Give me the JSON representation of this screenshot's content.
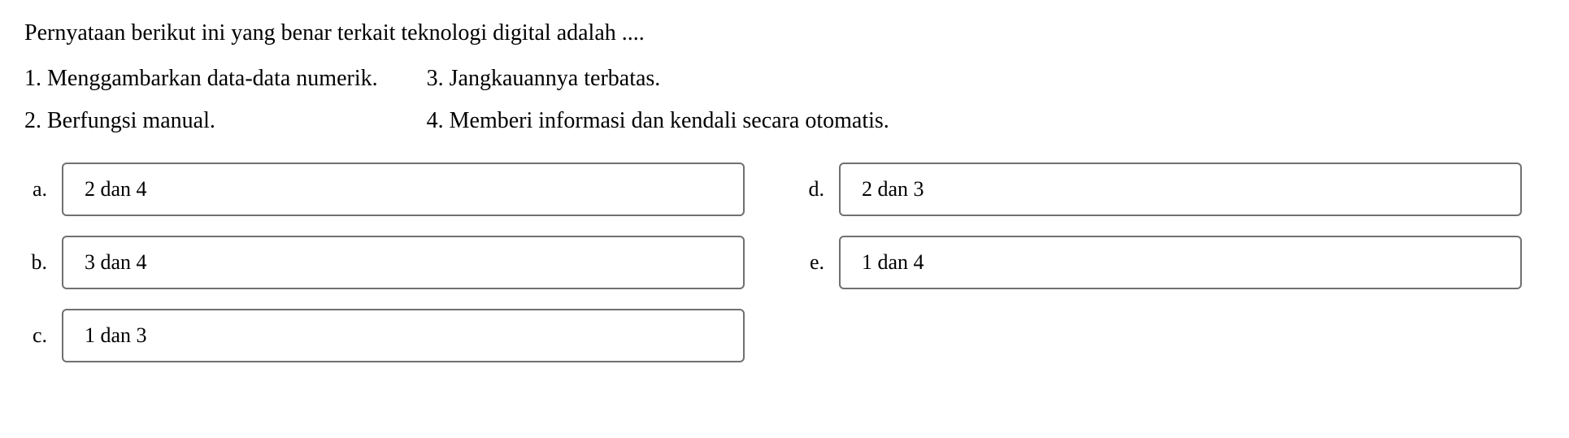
{
  "question": {
    "stem": "Pernyataan berikut ini yang benar terkait teknologi digital  adalah ....",
    "statements": {
      "s1": "1. Menggambarkan data-data numerik.",
      "s2": "2. Berfungsi manual.",
      "s3": "3. Jangkauannya terbatas.",
      "s4": "4. Memberi informasi dan kendali secara otomatis."
    },
    "options": {
      "a": {
        "letter": "a.",
        "text": "2 dan 4"
      },
      "b": {
        "letter": "b.",
        "text": "3 dan 4"
      },
      "c": {
        "letter": "c.",
        "text": "1 dan 3"
      },
      "d": {
        "letter": "d.",
        "text": "2 dan 3"
      },
      "e": {
        "letter": "e.",
        "text": "1 dan 4"
      }
    }
  }
}
